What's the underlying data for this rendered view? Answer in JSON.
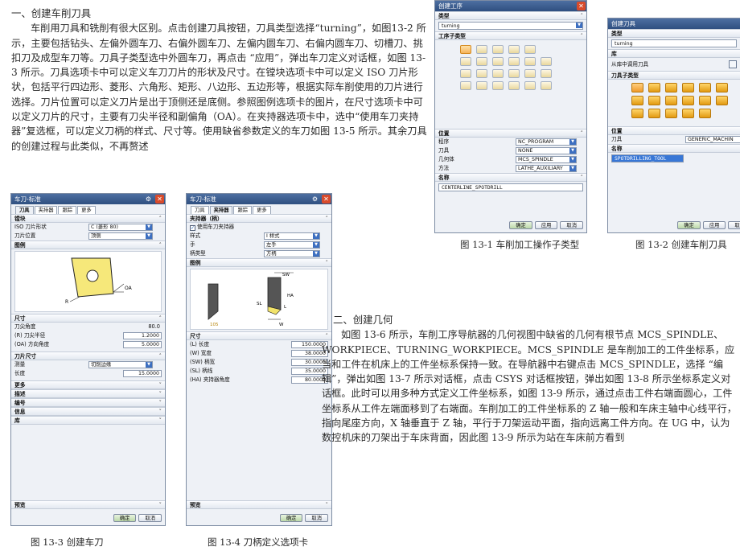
{
  "section1": {
    "heading": "一、创建车削刀具",
    "body": "车削用刀具和铣削有很大区别。点击创建刀具按钮，刀具类型选择“turning”，如图13-2 所示，主要包括钻头、左偏外圆车刀、右偏外圆车刀、左偏内圆车刀、右偏内圆车刀、切槽刀、挑扣刀及成型车刀等。刀具子类型选中外圆车刀，再点击 “应用”，弹出车刀定义对话框，如图 13-3 所示。刀具选项卡中可以定义车刀刀片的形状及尺寸。在镗块选项卡中可以定义 ISO 刀片形状，包括平行四边形、菱形、六角形、矩形、八边形、五边形等，根据实际车削使用的刀片进行选择。刀片位置可以定义刀片是出于顶侧还是底侧。参照图例选项卡的图片，在尺寸选项卡中可以定义刀片的尺寸，主要有刀尖半径和副偏角（OA）。在夹持器选项卡中，选中“使用车刀夹持器”复选框，可以定义刀柄的样式、尺寸等。使用缺省参数定义的车刀如图 13-5 所示。其余刀具的创建过程与此类似，不再赘述"
  },
  "section2": {
    "heading": "二、创建几何",
    "body": "如图 13-6 所示，车削工序导航器的几何视图中缺省的几何有根节点 MCS_SPINDLE、WORKPIECE、TURNING_WORKPIECE。MCS_SPINDLE 是车削加工的工件坐标系，应当和工件在机床上的工件坐标系保持一致。在导航器中右键点击 MCS_SPINDLE，选择 “编辑”，弹出如图 13-7 所示对话框，点击 CSYS 对话框按钮，弹出如图 13-8 所示坐标系定义对话框。此时可以用多种方式定义工件坐标系，如图 13-9 所示，通过点击工件右端面圆心，工件坐标系从工件左端面移到了右端面。车削加工的工件坐标系的 Z 轴一般和车床主轴中心线平行，指向尾座方向，X 轴垂直于 Z 轴，平行于刀架运动平面，指向远离工件方向。在 UG 中，认为数控机床的刀架出于车床背面，因此图 13-9 所示为站在车床前方看到"
  },
  "captions": {
    "fig1": "图 13-1  车削加工操作子类型",
    "fig2": "图 13-2  创建车削刀具",
    "fig3": "图 13-3  创建车刀",
    "fig4": "图 13-4  刀柄定义选项卡"
  },
  "dlg_op": {
    "title": "创建工序",
    "type_label": "类型",
    "type_value": "turning",
    "subtype_label": "工序子类型",
    "location_label": "位置",
    "rows": [
      {
        "label": "程序",
        "value": "NC_PROGRAM"
      },
      {
        "label": "刀具",
        "value": "NONE"
      },
      {
        "label": "几何体",
        "value": "MCS_SPINDLE"
      },
      {
        "label": "方法",
        "value": "LATHE_AUXILIARY"
      }
    ],
    "name_label": "名称",
    "name_value": "CENTERLINE_SPOTDRILL",
    "ok": "确定",
    "apply": "应用",
    "cancel": "取消"
  },
  "dlg_tool": {
    "title": "创建刀具",
    "type_label": "类型",
    "type_value": "turning",
    "lib_label": "库",
    "lib_row": "从库中调用刀具",
    "subtype_label": "刀具子类型",
    "location_label": "位置",
    "tool_label": "刀具",
    "tool_value": "GENERIC_MACHIN",
    "name_label": "名称",
    "name_value": "SPOTDRILLING_TOOL",
    "ok": "确定",
    "apply": "应用",
    "cancel": "取消"
  },
  "dlg_std": {
    "title": "车刀-标准",
    "tabs": [
      "刀具",
      "夹持器",
      "跟踪",
      "更多"
    ],
    "insert_section": "镗块",
    "iso_label": "ISO 刀片形状",
    "iso_value": "C (菱形 80)",
    "pos_label": "刀片位置",
    "pos_value": "顶侧",
    "legend_section": "图例",
    "legend_oa": "OA",
    "legend_r": "R",
    "size_section": "尺寸",
    "size_rows": [
      {
        "label": "刀尖角度",
        "value": "80.0"
      },
      {
        "label": "(R) 刀尖半径",
        "value": "1.2000"
      },
      {
        "label": "(OA) 方向角度",
        "value": "5.0000"
      }
    ],
    "cut_section": "刀片尺寸",
    "measure_label": "测量",
    "measure_value": "切削边缘",
    "length_label": "长度",
    "length_value": "15.0000",
    "collapsed": [
      "更多",
      "描述",
      "编号",
      "信息",
      "库"
    ],
    "preview": "预览",
    "ok": "确定",
    "cancel": "取消"
  },
  "dlg_holder": {
    "title": "车刀-标准",
    "tabs": [
      "刀具",
      "夹持器",
      "跟踪",
      "更多"
    ],
    "holder_section": "夹持器（柄）",
    "use_holder": "使用车刀夹持器",
    "style_label": "样式",
    "style_value": "I 样式",
    "hand_label": "手",
    "hand_value": "左手",
    "shank_label": "柄类型",
    "shank_value": "方柄",
    "legend_section": "图例",
    "legend_105": "105",
    "legend_sw": "SW",
    "legend_sl": "SL",
    "legend_ha": "HA",
    "legend_l": "L",
    "legend_w": "W",
    "size_section": "尺寸",
    "size_rows": [
      {
        "label": "(L) 长度",
        "value": "150.0000"
      },
      {
        "label": "(W) 宽度",
        "value": "38.0000"
      },
      {
        "label": "(SW) 柄宽",
        "value": "30.0000"
      },
      {
        "label": "(SL) 柄线",
        "value": "35.0000"
      },
      {
        "label": "(HA) 夹持器角度",
        "value": "80.0000"
      }
    ],
    "preview": "预览",
    "ok": "确定",
    "cancel": "取消"
  }
}
